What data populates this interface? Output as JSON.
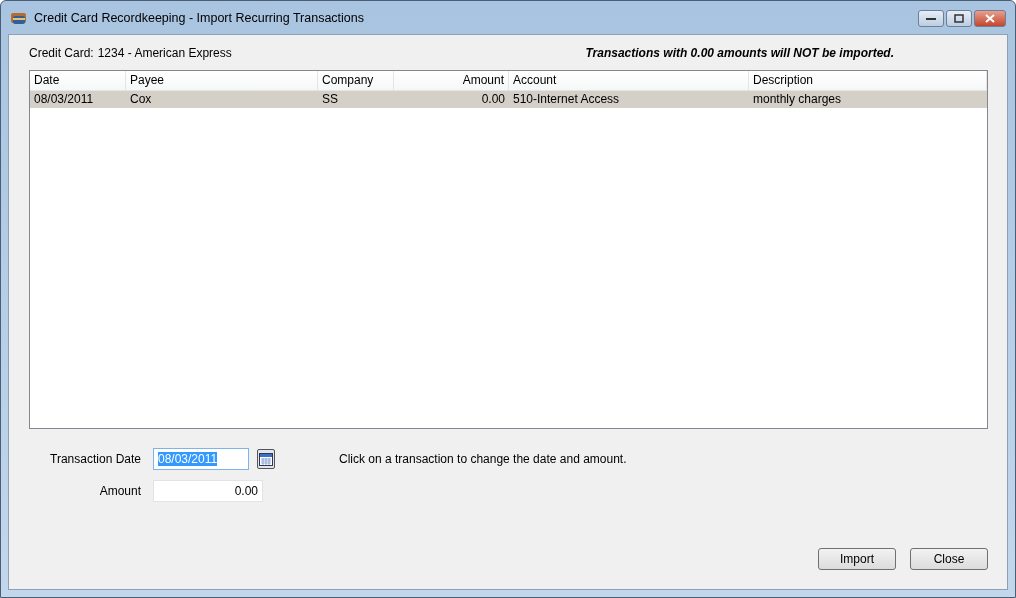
{
  "window": {
    "title": "Credit Card Recordkeeping - Import Recurring Transactions"
  },
  "credit_card": {
    "label": "Credit Card:",
    "value": "1234 - American Express"
  },
  "notice": "Transactions with 0.00 amounts will NOT be imported.",
  "table": {
    "columns": [
      "Date",
      "Payee",
      "Company",
      "Amount",
      "Account",
      "Description"
    ],
    "rows": [
      {
        "selected": true,
        "cells": [
          "08/03/2011",
          "Cox",
          "SS",
          "0.00",
          "510-Internet Access",
          "monthly charges"
        ]
      }
    ]
  },
  "form": {
    "date": {
      "label": "Transaction Date",
      "value": "08/03/2011",
      "text_selected": true
    },
    "amount": {
      "label": "Amount",
      "value": "0.00"
    },
    "hint": "Click on a transaction to change the date and amount."
  },
  "buttons": [
    "Import",
    "Close"
  ]
}
